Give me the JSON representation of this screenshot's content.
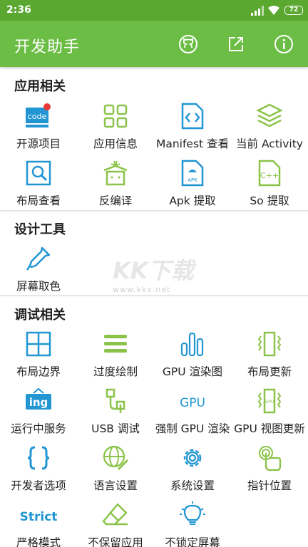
{
  "status": {
    "time": "2:36",
    "battery": "72"
  },
  "appbar": {
    "title": "开发助手"
  },
  "sections": {
    "app": {
      "title": "应用相关"
    },
    "design": {
      "title": "设计工具"
    },
    "debug": {
      "title": "调试相关"
    }
  },
  "items": {
    "open_source": "开源项目",
    "app_info": "应用信息",
    "manifest": "Manifest 查看",
    "current_activity": "当前 Activity",
    "layout_view": "布局查看",
    "decompile": "反编译",
    "apk_extract": "Apk 提取",
    "so_extract": "So 提取",
    "color_picker": "屏幕取色",
    "layout_bounds": "布局边界",
    "overdraw": "过度绘制",
    "gpu_render": "GPU 渲染图",
    "layout_update": "布局更新",
    "running_services": "运行中服务",
    "usb_debug": "USB 调试",
    "force_gpu": "强制 GPU 渲染",
    "gpu_view_update": "GPU 视图更新",
    "developer_options": "开发者选项",
    "language_settings": "语言设置",
    "system_settings": "系统设置",
    "pointer_location": "指针位置",
    "strict_mode": "严格模式",
    "dont_keep_activities": "不保留应用",
    "stay_awake": "不锁定屏幕"
  },
  "icon_text": {
    "code": "code",
    "ing": "ing",
    "gpu": "GPU",
    "strict": "Strict",
    "apk": "APK",
    "cpp": "C++"
  },
  "watermark": {
    "main": "KK下载",
    "url": "www.kkx.net"
  },
  "colors": {
    "primary": "#6cbd45",
    "status": "#5aa830",
    "icon_blue": "#2196d3",
    "icon_green": "#8bc34a",
    "badge": "#e53935"
  }
}
